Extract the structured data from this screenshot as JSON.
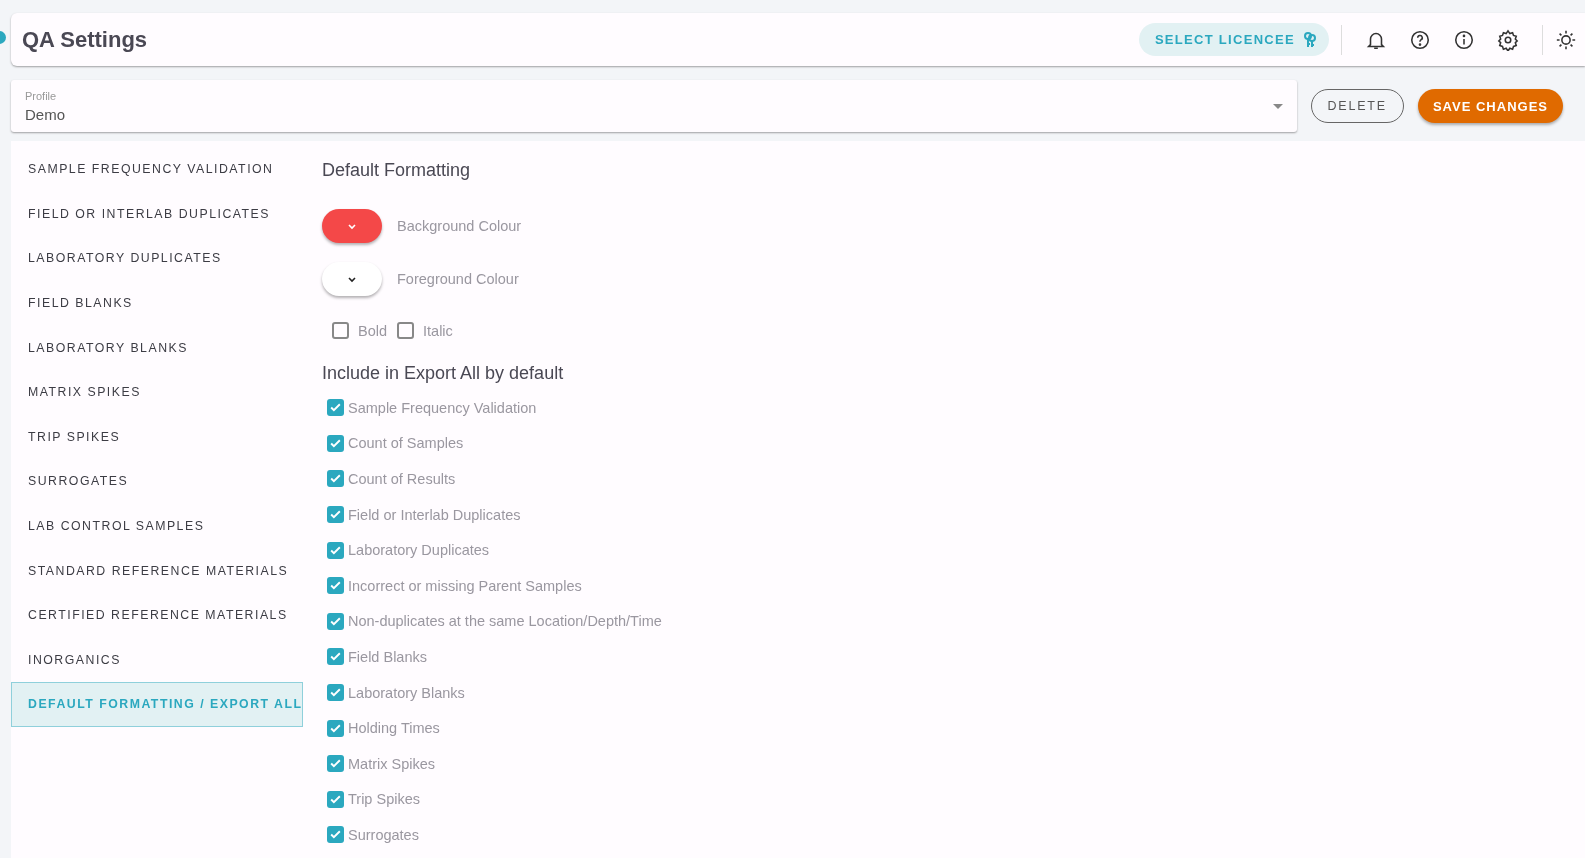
{
  "header": {
    "title": "QA Settings",
    "licensee_button": "SELECT LICENCEE"
  },
  "profile": {
    "label": "Profile",
    "value": "Demo"
  },
  "actions": {
    "delete": "DELETE",
    "save": "SAVE CHANGES"
  },
  "sidebar": {
    "items": [
      {
        "label": "SAMPLE FREQUENCY VALIDATION",
        "selected": false
      },
      {
        "label": "FIELD OR INTERLAB DUPLICATES",
        "selected": false
      },
      {
        "label": "LABORATORY DUPLICATES",
        "selected": false
      },
      {
        "label": "FIELD BLANKS",
        "selected": false
      },
      {
        "label": "LABORATORY BLANKS",
        "selected": false
      },
      {
        "label": "MATRIX SPIKES",
        "selected": false
      },
      {
        "label": "TRIP SPIKES",
        "selected": false
      },
      {
        "label": "SURROGATES",
        "selected": false
      },
      {
        "label": "LAB CONTROL SAMPLES",
        "selected": false
      },
      {
        "label": "STANDARD REFERENCE MATERIALS",
        "selected": false
      },
      {
        "label": "CERTIFIED REFERENCE MATERIALS",
        "selected": false
      },
      {
        "label": "INORGANICS",
        "selected": false
      },
      {
        "label": "DEFAULT FORMATTING / EXPORT ALL",
        "selected": true
      }
    ]
  },
  "formatting": {
    "title": "Default Formatting",
    "colours": [
      {
        "label": "Background Colour",
        "color": "#f44848"
      },
      {
        "label": "Foreground Colour",
        "color": "#ffffff"
      }
    ],
    "styles": [
      {
        "label": "Bold",
        "checked": false
      },
      {
        "label": "Italic",
        "checked": false
      }
    ]
  },
  "export": {
    "title": "Include in Export All by default",
    "items": [
      {
        "label": "Sample Frequency Validation",
        "checked": true
      },
      {
        "label": "Count of Samples",
        "checked": true
      },
      {
        "label": "Count of Results",
        "checked": true
      },
      {
        "label": "Field or Interlab Duplicates",
        "checked": true
      },
      {
        "label": "Laboratory Duplicates",
        "checked": true
      },
      {
        "label": "Incorrect or missing Parent Samples",
        "checked": true
      },
      {
        "label": "Non-duplicates at the same Location/Depth/Time",
        "checked": true
      },
      {
        "label": "Field Blanks",
        "checked": true
      },
      {
        "label": "Laboratory Blanks",
        "checked": true
      },
      {
        "label": "Holding Times",
        "checked": true
      },
      {
        "label": "Matrix Spikes",
        "checked": true
      },
      {
        "label": "Trip Spikes",
        "checked": true
      },
      {
        "label": "Surrogates",
        "checked": true
      }
    ]
  }
}
